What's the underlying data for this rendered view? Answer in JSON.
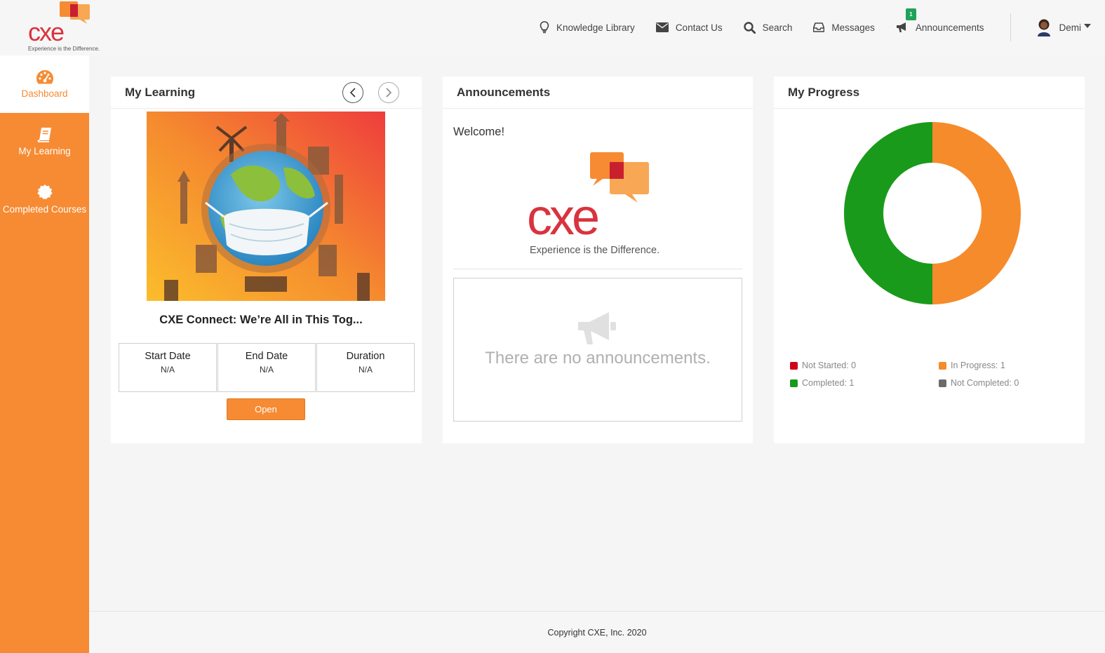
{
  "brand": {
    "name": "cxe",
    "tagline": "Experience is the Difference.",
    "colors": {
      "orange": "#f68b33",
      "red": "#d9333f",
      "darkred": "#b01e2c"
    }
  },
  "topnav": {
    "knowledge_library": "Knowledge Library",
    "contact_us": "Contact Us",
    "search": "Search",
    "messages": "Messages",
    "announcements": "Announcements",
    "announcements_badge": "1",
    "user_name": "Demi"
  },
  "sidebar": {
    "items": [
      {
        "label": "Dashboard",
        "icon": "dashboard-gauge-icon"
      },
      {
        "label": "My Learning",
        "icon": "book-icon"
      },
      {
        "label": "Completed Courses",
        "icon": "certificate-badge-icon"
      }
    ]
  },
  "my_learning": {
    "title": "My Learning",
    "course_title": "CXE Connect: We’re All in This Tog...",
    "start_date_label": "Start Date",
    "start_date_value": "N/A",
    "end_date_label": "End Date",
    "end_date_value": "N/A",
    "duration_label": "Duration",
    "duration_value": "N/A",
    "open_label": "Open"
  },
  "announcements": {
    "title": "Announcements",
    "welcome": "Welcome!",
    "empty_text": "There are no announcements."
  },
  "progress": {
    "title": "My Progress",
    "legend": [
      {
        "label": "Not Started: 0",
        "color": "#d0021b",
        "value": 0
      },
      {
        "label": "In Progress: 1",
        "color": "#f68b2b",
        "value": 1
      },
      {
        "label": "Completed: 1",
        "color": "#1a9a1a",
        "value": 1
      },
      {
        "label": "Not Completed: 0",
        "color": "#6b6b6b",
        "value": 0
      }
    ]
  },
  "footer": {
    "copyright": "Copyright CXE, Inc. 2020"
  }
}
